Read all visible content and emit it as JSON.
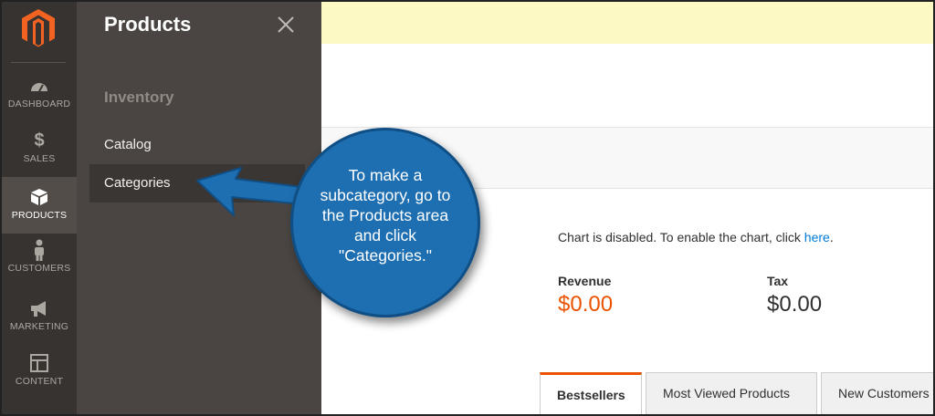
{
  "nav": {
    "items": [
      {
        "label": "DASHBOARD",
        "icon": "dashboard-gauge-icon"
      },
      {
        "label": "SALES",
        "icon": "dollar-icon"
      },
      {
        "label": "PRODUCTS",
        "icon": "box-icon"
      },
      {
        "label": "CUSTOMERS",
        "icon": "person-icon"
      },
      {
        "label": "MARKETING",
        "icon": "megaphone-icon"
      },
      {
        "label": "CONTENT",
        "icon": "layout-icon"
      }
    ],
    "active": "PRODUCTS"
  },
  "flyout": {
    "title": "Products",
    "section": "Inventory",
    "links": [
      "Catalog",
      "Categories"
    ],
    "active_link": "Categories"
  },
  "dashboard": {
    "chart_message": "Chart is disabled. To enable the chart, click ",
    "chart_link": "here",
    "chart_message_end": ".",
    "revenue_label": "Revenue",
    "revenue_value": "$0.00",
    "tax_label": "Tax",
    "tax_value": "$0.00",
    "tabs": [
      "Bestsellers",
      "Most Viewed Products",
      "New Customers"
    ],
    "active_tab": "Bestsellers"
  },
  "callout": {
    "lines": [
      "To make a",
      "subcategory, go to",
      "the Products area",
      "and click",
      "\"Categories.\""
    ]
  },
  "colors": {
    "accent": "#eb5202",
    "link": "#007bdb",
    "callout": "#1e6fb2",
    "nav_bg": "#373330",
    "flyout_bg": "#4a4542"
  }
}
